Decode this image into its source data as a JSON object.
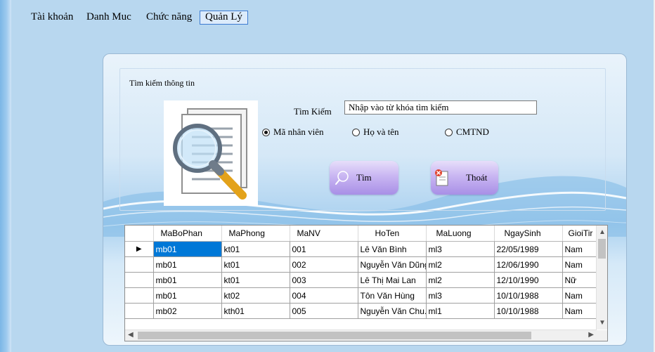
{
  "menu": {
    "items": [
      {
        "label": "Tài khoản"
      },
      {
        "label": "Danh Muc"
      },
      {
        "label": "Chức năng"
      },
      {
        "label": "Quản Lý"
      }
    ]
  },
  "search_panel": {
    "group_title": "Tìm kiếm thông tin",
    "search_label": "Tìm Kiếm",
    "search_value": "Nhập vào từ khóa tìm kiếm",
    "radios": [
      {
        "label": "Mã nhân viên",
        "checked": true
      },
      {
        "label": "Họ và tên",
        "checked": false
      },
      {
        "label": "CMTND",
        "checked": false
      }
    ],
    "search_button": "Tìm",
    "exit_button": "Thoát"
  },
  "grid": {
    "columns": [
      "MaBoPhan",
      "MaPhong",
      "MaNV",
      "HoTen",
      "MaLuong",
      "NgaySinh",
      "GioiTir"
    ],
    "rows": [
      [
        "mb01",
        "kt01",
        "001",
        "Lê Văn Bình",
        "ml3",
        "22/05/1989",
        "Nam"
      ],
      [
        "mb01",
        "kt01",
        "002",
        "Nguyễn Văn Dũng",
        "ml2",
        "12/06/1990",
        "Nam"
      ],
      [
        "mb01",
        "kt01",
        "003",
        "Lê Thị Mai Lan",
        "ml2",
        "12/10/1990",
        "Nữ"
      ],
      [
        "mb01",
        "kt02",
        "004",
        "Tôn Văn Hùng",
        "ml3",
        "10/10/1988",
        "Nam"
      ],
      [
        "mb02",
        "kth01",
        "005",
        "Nguyễn Văn Chu...",
        "ml1",
        "10/10/1988",
        "Nam"
      ]
    ],
    "selected_row": 0
  },
  "colors": {
    "accent": "#0078d7",
    "button_purple": "#b9a2ee",
    "mdi_background": "#b8d7ef"
  },
  "icons": {
    "search_image": "magnifier-document-icon",
    "search_button_icon": "magnifier-icon",
    "exit_button_icon": "exit-document-icon",
    "row_indicator": "current-row-arrow-icon"
  }
}
